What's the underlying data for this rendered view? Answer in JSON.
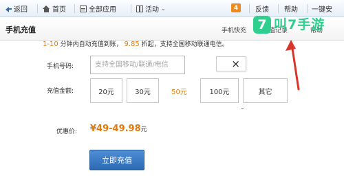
{
  "nav": {
    "back": "返回",
    "home": "首页",
    "all_apps": "全部应用",
    "activity": "活动",
    "badge_count": "4",
    "feedback": "反馈",
    "help": "帮助",
    "install": "一键安"
  },
  "header": {
    "title": "手机充值",
    "link_quick": "手机快充",
    "link_records": "充值记录",
    "link_help": "帮助"
  },
  "watermark": {
    "badge": "7",
    "text": "叫7手游"
  },
  "notice": {
    "minutes": "1-10",
    "text1": " 分钟内自动充值到账， ",
    "discount": "9.85",
    "text2": " 折起，支持全国移动联通电信。"
  },
  "form": {
    "phone_label": "手机号码:",
    "phone_placeholder": "支持全国移动/联通/电信",
    "phone_value": "",
    "tooltip_close": "×",
    "amount_label": "充值金额:",
    "amounts": [
      "20元",
      "30元",
      "50元",
      "100元",
      "其它"
    ],
    "selected_amount": "50元",
    "other_caret": "⌄",
    "price_label": "优惠价:",
    "price": "¥49-49.98",
    "price_unit": "元",
    "submit": "立即充值"
  },
  "colors": {
    "accent_orange": "#e07a10",
    "button_blue": "#2c69b3",
    "watermark_green": "#2ecf8f",
    "arrow_red": "#d9362b"
  }
}
